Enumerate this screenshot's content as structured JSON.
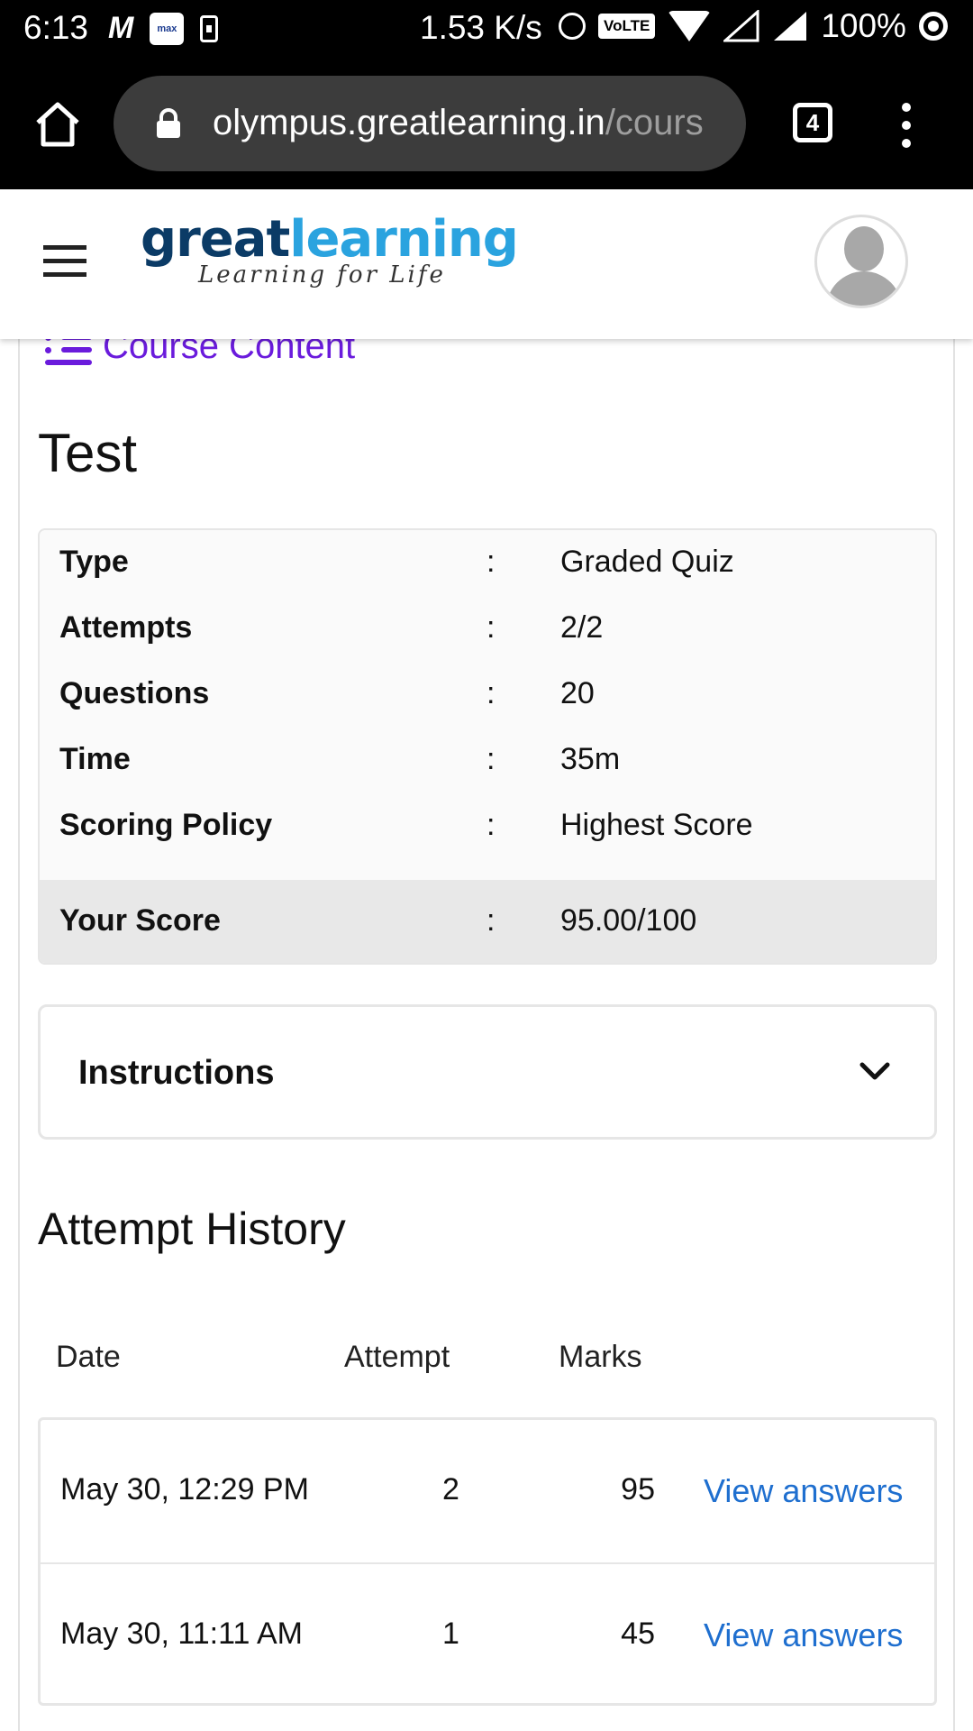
{
  "status_bar": {
    "time": "6:13",
    "m_icon": "M",
    "max_badge": "max",
    "net_speed": "1.53 K/s",
    "volte": "VoLTE",
    "battery": "100%"
  },
  "browser": {
    "url_host": "olympus.greatlearning.in",
    "url_path": "/cours",
    "tab_count": "4"
  },
  "header": {
    "logo_great": "great",
    "logo_learning": "learning",
    "logo_tagline": "Learning for Life"
  },
  "course_content_link": "Course Content",
  "page_title": "Test",
  "info": {
    "rows": [
      {
        "label": "Type",
        "colon": ":",
        "value": "Graded Quiz"
      },
      {
        "label": "Attempts",
        "colon": ":",
        "value": "2/2"
      },
      {
        "label": "Questions",
        "colon": ":",
        "value": "20"
      },
      {
        "label": "Time",
        "colon": ":",
        "value": "35m"
      },
      {
        "label": "Scoring Policy",
        "colon": ":",
        "value": "Highest Score"
      }
    ],
    "score": {
      "label": "Your Score",
      "colon": ":",
      "value": "95.00/100"
    }
  },
  "instructions": {
    "label": "Instructions"
  },
  "attempt_history": {
    "title": "Attempt History",
    "columns": [
      "Date",
      "Attempt",
      "Marks"
    ],
    "rows": [
      {
        "date": "May 30, 12:29 PM",
        "attempt": "2",
        "marks": "95",
        "link": "View answers"
      },
      {
        "date": "May 30, 11:11 AM",
        "attempt": "1",
        "marks": "45",
        "link": "View answers"
      }
    ]
  },
  "colors": {
    "accent_purple": "#6a1bdc",
    "link_blue": "#1f6fcf",
    "logo_dark": "#0b3b66",
    "logo_light": "#2aa3df"
  }
}
